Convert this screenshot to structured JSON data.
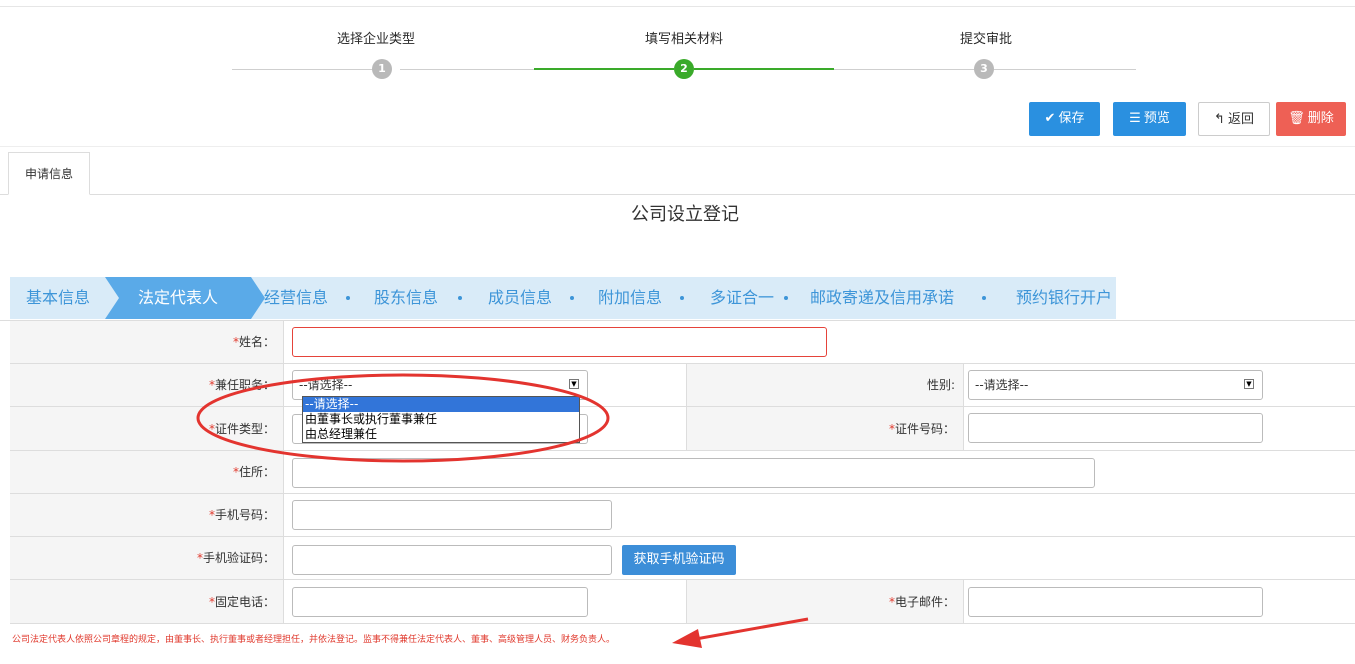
{
  "stepper": {
    "steps": [
      {
        "label": "选择企业类型",
        "number": "1",
        "active": false
      },
      {
        "label": "填写相关材料",
        "number": "2",
        "active": true
      },
      {
        "label": "提交审批",
        "number": "3",
        "active": false
      }
    ]
  },
  "toolbar": {
    "save_label": "保存",
    "preview_label": "预览",
    "back_label": "返回",
    "delete_label": "删除",
    "save_icon": "check-icon",
    "preview_icon": "list-icon",
    "back_icon": "back-arrow-icon",
    "delete_icon": "trash-icon"
  },
  "tabs": [
    {
      "label": "申请信息"
    }
  ],
  "page_title": "公司设立登记",
  "section_nav": {
    "items": [
      "基本信息",
      "法定代表人",
      "经营信息",
      "股东信息",
      "成员信息",
      "附加信息",
      "多证合一",
      "邮政寄递及信用承诺",
      "预约银行开户"
    ],
    "active_index": 1
  },
  "form": {
    "name_label": "姓名：",
    "position_label": "兼任职务：",
    "position_value": "--请选择--",
    "position_options": [
      "--请选择--",
      "由董事长或执行董事兼任",
      "由总经理兼任"
    ],
    "gender_label": "性别:",
    "gender_value": "--请选择--",
    "id_type_label": "证件类型：",
    "id_number_label": "证件号码：",
    "address_label": "住所：",
    "mobile_label": "手机号码：",
    "sms_label": "手机验证码：",
    "get_code_label": "获取手机验证码",
    "phone_label": "固定电话：",
    "email_label": "电子邮件：",
    "required_mark": "*",
    "notice": "公司法定代表人依照公司章程的规定，由董事长、执行董事或者经理担任，并依法登记。监事不得兼任法定代表人、董事、高级管理人员、财务负责人。"
  },
  "colors": {
    "accent_blue": "#2a90e0",
    "step_active": "#3aaa2a",
    "danger": "#ee6055",
    "annotation_red": "#e3342f",
    "nav_bg": "#d9ebf8"
  }
}
